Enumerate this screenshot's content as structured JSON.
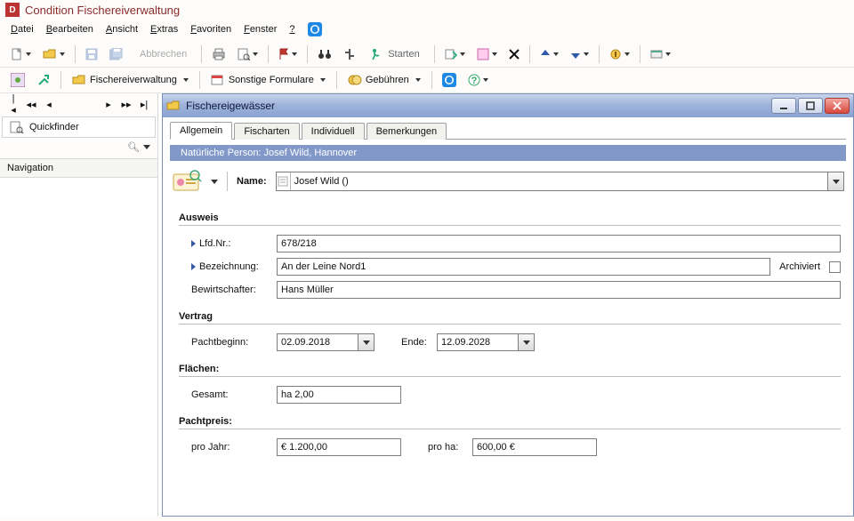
{
  "app": {
    "title": "Condition Fischereiverwaltung"
  },
  "menubar": {
    "items": [
      "Datei",
      "Bearbeiten",
      "Ansicht",
      "Extras",
      "Favoriten",
      "Fenster",
      "?"
    ]
  },
  "toolbar1": {
    "abort": "Abbrechen",
    "start": "Starten"
  },
  "toolbar2": {
    "fischerei": "Fischereiverwaltung",
    "sonstige": "Sonstige Formulare",
    "gebuehren": "Gebühren"
  },
  "sidebar": {
    "quickfinder": "Quickfinder",
    "navigation": "Navigation"
  },
  "mdi": {
    "title": "Fischereigewässer",
    "tabs": [
      "Allgemein",
      "Fischarten",
      "Individuell",
      "Bemerkungen"
    ],
    "banner": "Natürliche Person: Josef Wild, Hannover",
    "name_label": "Name:",
    "name_value": "Josef Wild ()",
    "groups": {
      "ausweis": {
        "title": "Ausweis",
        "lfdnr_label": "Lfd.Nr.:",
        "lfdnr_value": "678/218",
        "bezeichnung_label": "Bezeichnung:",
        "bezeichnung_value": "An der Leine Nord1",
        "archiviert_label": "Archiviert",
        "bewirtschafter_label": "Bewirtschafter:",
        "bewirtschafter_value": "Hans Müller"
      },
      "vertrag": {
        "title": "Vertrag",
        "pachtbeginn_label": "Pachtbeginn:",
        "pachtbeginn_value": "02.09.2018",
        "ende_label": "Ende:",
        "ende_value": "12.09.2028"
      },
      "flaechen": {
        "title": "Flächen:",
        "gesamt_label": "Gesamt:",
        "gesamt_value": "ha 2,00"
      },
      "pachtpreis": {
        "title": "Pachtpreis:",
        "projahr_label": "pro Jahr:",
        "projahr_value": "€ 1.200,00",
        "proha_label": "pro ha:",
        "proha_value": "600,00 €"
      }
    }
  }
}
